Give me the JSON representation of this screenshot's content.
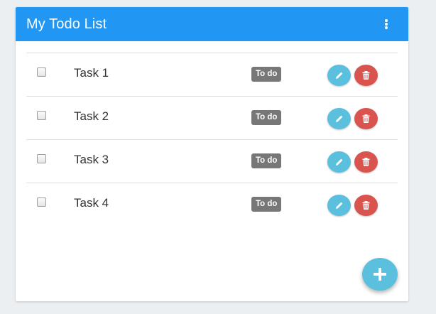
{
  "header": {
    "title": "My Todo List",
    "menu_icon": "more-vert-icon",
    "color": "#2196f3"
  },
  "todos": [
    {
      "text": "Task 1",
      "status": "To do",
      "checked": false
    },
    {
      "text": "Task 2",
      "status": "To do",
      "checked": false
    },
    {
      "text": "Task 3",
      "status": "To do",
      "checked": false
    },
    {
      "text": "Task 4",
      "status": "To do",
      "checked": false
    }
  ],
  "actions": {
    "edit_icon": "pencil-icon",
    "delete_icon": "trash-icon",
    "edit_color": "#5bc0de",
    "delete_color": "#d9534f"
  },
  "fab": {
    "icon": "plus-icon",
    "color": "#5bc0de"
  },
  "status_badge_color": "#777777"
}
